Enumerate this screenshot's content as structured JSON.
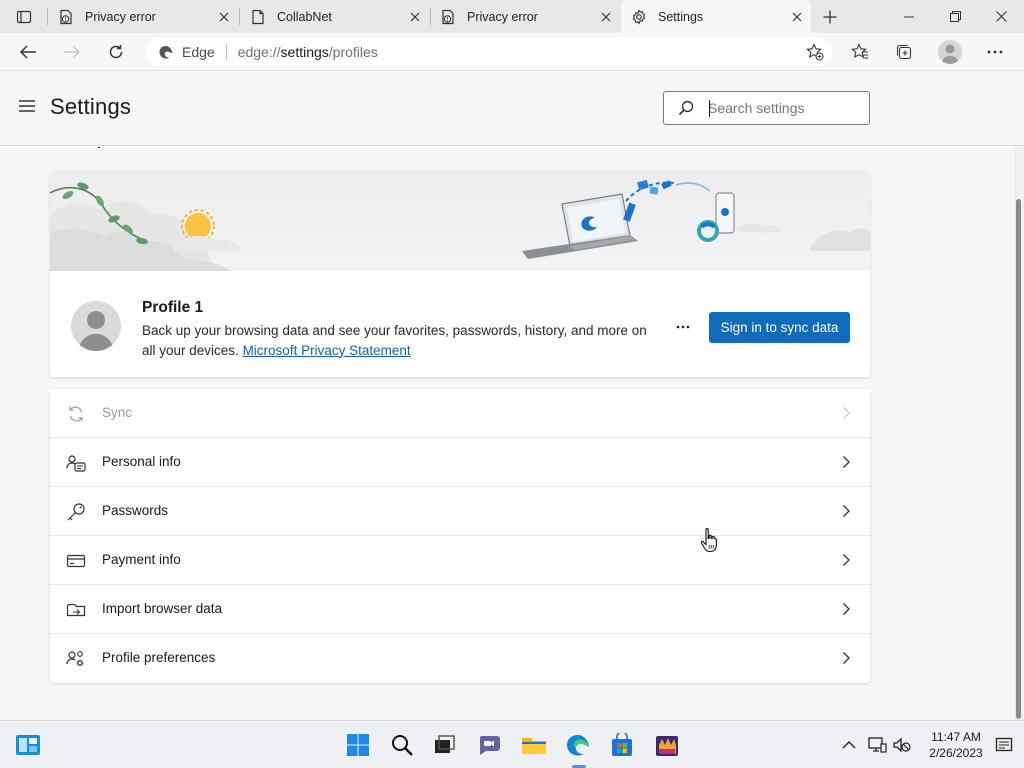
{
  "tabs": [
    {
      "title": "Privacy error",
      "icon": "warning-page-icon",
      "active": false
    },
    {
      "title": "CollabNet",
      "icon": "page-icon",
      "active": false
    },
    {
      "title": "Privacy error",
      "icon": "warning-page-icon",
      "active": false
    },
    {
      "title": "Settings",
      "icon": "gear-icon",
      "active": true
    }
  ],
  "address_bar": {
    "site_label": "Edge",
    "url_scheme": "edge://",
    "url_host": "settings",
    "url_path": "/profiles"
  },
  "settings": {
    "title": "Settings",
    "search_placeholder": "Search settings"
  },
  "profile": {
    "name": "Profile 1",
    "description": "Back up your browsing data and see your favorites, passwords, history, and more on all your devices.",
    "privacy_link": "Microsoft Privacy Statement",
    "more_label": "···",
    "sign_in_button": "Sign in to sync data"
  },
  "menu_items": [
    {
      "label": "Sync",
      "icon": "sync-icon",
      "disabled": true
    },
    {
      "label": "Personal info",
      "icon": "person-card-icon",
      "disabled": false
    },
    {
      "label": "Passwords",
      "icon": "key-icon",
      "disabled": false
    },
    {
      "label": "Payment info",
      "icon": "credit-card-icon",
      "disabled": false
    },
    {
      "label": "Import browser data",
      "icon": "import-icon",
      "disabled": false
    },
    {
      "label": "Profile preferences",
      "icon": "people-settings-icon",
      "disabled": false
    }
  ],
  "taskbar": {
    "time": "11:47 AM",
    "date": "2/26/2023"
  },
  "colors": {
    "accent": "#0f6cbd",
    "link": "#1560b8"
  }
}
